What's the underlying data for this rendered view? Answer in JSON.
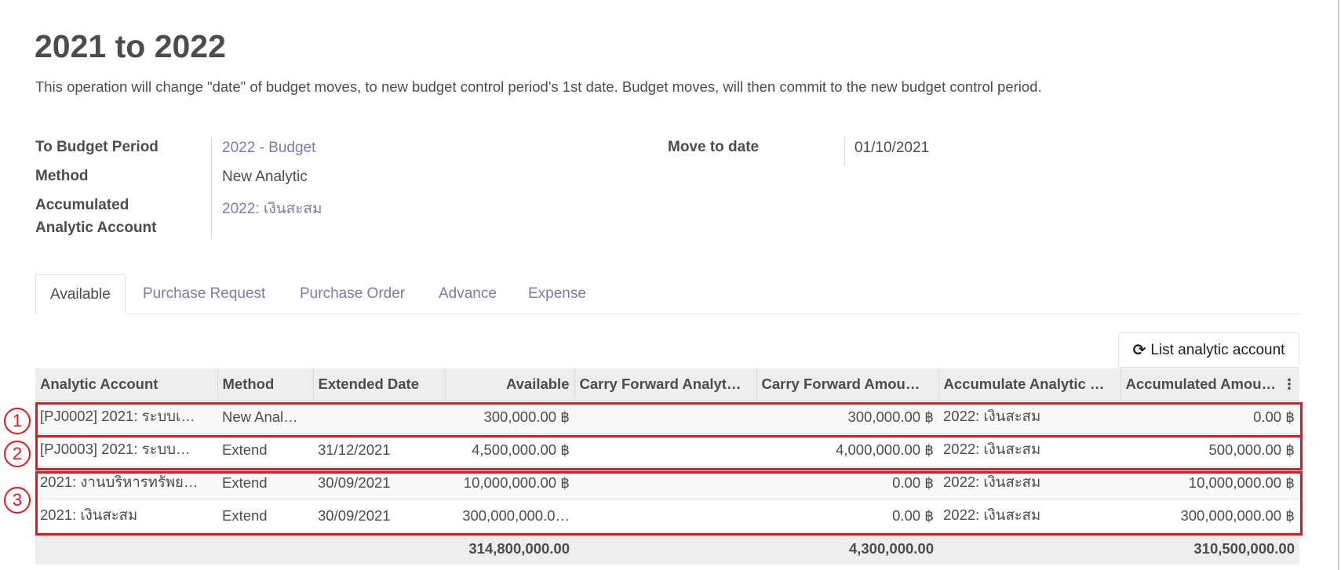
{
  "page": {
    "title": "2021 to 2022",
    "description": "This operation will change \"date\" of budget moves, to new budget control period's 1st date. Budget moves, will then commit to the new budget control period."
  },
  "form": {
    "to_budget_period_label": "To Budget Period",
    "to_budget_period_value": "2022 - Budget",
    "method_label": "Method",
    "method_value": "New Analytic",
    "accumulated_label_line1": "Accumulated",
    "accumulated_label_line2": "Analytic Account",
    "accumulated_value": "2022: เงินสะสม",
    "move_to_date_label": "Move to date",
    "move_to_date_value": "01/10/2021"
  },
  "tabs": [
    {
      "label": "Available",
      "active": true
    },
    {
      "label": "Purchase Request",
      "active": false
    },
    {
      "label": "Purchase Order",
      "active": false
    },
    {
      "label": "Advance",
      "active": false
    },
    {
      "label": "Expense",
      "active": false
    }
  ],
  "list_button": {
    "label": "List analytic account",
    "icon": "refresh-icon"
  },
  "table": {
    "headers": [
      "Analytic Account",
      "Method",
      "Extended Date",
      "Available",
      "Carry Forward Analyt…",
      "Carry Forward Amou…",
      "Accumulate Analytic …",
      "Accumulated Amou…"
    ],
    "rows": [
      [
        "[PJ0002] 2021: ระบบเ…",
        "New Anal…",
        "",
        "300,000.00 ฿",
        "",
        "300,000.00 ฿",
        "2022: เงินสะสม",
        "0.00 ฿"
      ],
      [
        "[PJ0003] 2021: ระบบ…",
        "Extend",
        "31/12/2021",
        "4,500,000.00 ฿",
        "",
        "4,000,000.00 ฿",
        "2022: เงินสะสม",
        "500,000.00 ฿"
      ],
      [
        "2021: งานบริหารทรัพย…",
        "Extend",
        "30/09/2021",
        "10,000,000.00 ฿",
        "",
        "0.00 ฿",
        "2022: เงินสะสม",
        "10,000,000.00 ฿"
      ],
      [
        "2021: เงินสะสม",
        "Extend",
        "30/09/2021",
        "300,000,000.0…",
        "",
        "0.00 ฿",
        "2022: เงินสะสม",
        "300,000,000.00 ฿"
      ]
    ],
    "totals": [
      "",
      "",
      "",
      "314,800,000.00",
      "",
      "4,300,000.00",
      "",
      "310,500,000.00"
    ]
  },
  "annotations": [
    "1",
    "2",
    "3"
  ],
  "colors": {
    "accent_link": "#7c7bad",
    "highlight": "#e8141e"
  }
}
